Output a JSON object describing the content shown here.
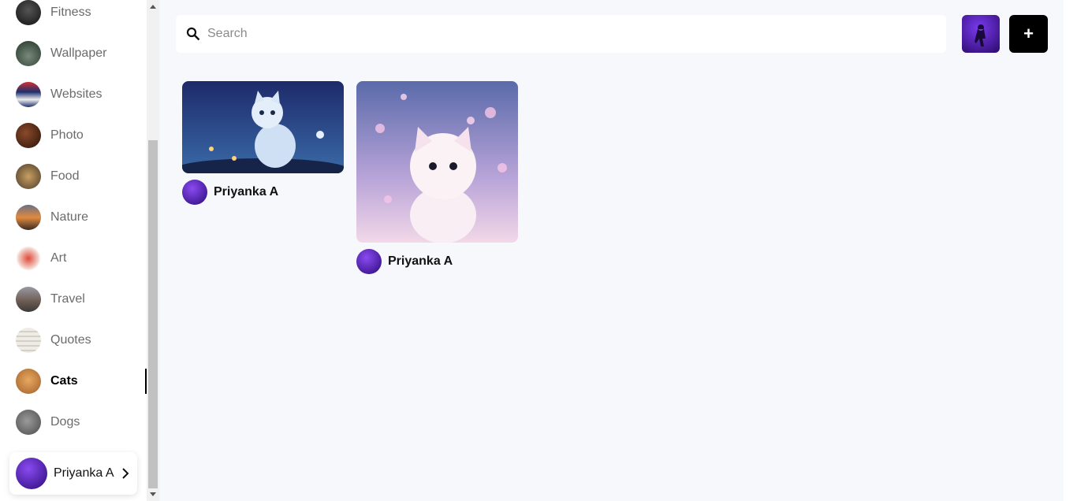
{
  "sidebar": {
    "categories": [
      {
        "label": "Fitness",
        "color": "#2b2b2b"
      },
      {
        "label": "Wallpaper",
        "color": "#2f4a3a"
      },
      {
        "label": "Websites",
        "color": "#2a3f7a"
      },
      {
        "label": "Photo",
        "color": "#5a2e1e"
      },
      {
        "label": "Food",
        "color": "#8a6a3a"
      },
      {
        "label": "Nature",
        "color": "#8a5a3a"
      },
      {
        "label": "Art",
        "color": "#d64a3a"
      },
      {
        "label": "Travel",
        "color": "#6a6a70"
      },
      {
        "label": "Quotes",
        "color": "#e6e2d8"
      },
      {
        "label": "Cats",
        "color": "#d08a3a"
      },
      {
        "label": "Dogs",
        "color": "#6a6a6a"
      }
    ],
    "active_category": "Cats",
    "profile": {
      "name": "Priyanka A"
    }
  },
  "search": {
    "placeholder": "Search",
    "value": ""
  },
  "header": {
    "add_label": "+"
  },
  "pins": [
    {
      "author": "Priyanka A",
      "image": "cat-night-icon"
    },
    {
      "author": "Priyanka A",
      "image": "cat-pink-icon"
    }
  ],
  "colors": {
    "accent": "#000000",
    "background": "#f7f8fb",
    "avatar": "#5b1fd6"
  }
}
